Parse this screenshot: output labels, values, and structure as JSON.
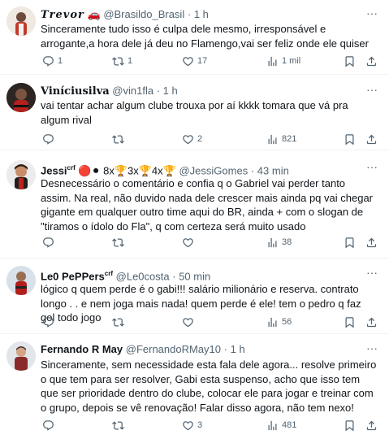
{
  "tweets": [
    {
      "name": "𝑻𝒓𝒆𝒗𝒐𝒓",
      "name_emoji": "🚗",
      "handle": "@Brasildo_Brasil",
      "time": "1 h",
      "text": "Sinceramente tudo isso é culpa dele mesmo, irresponsável e arrogante,a hora dele já deu no Flamengo,vai ser feliz onde ele quiser",
      "replies": "1",
      "retweets": "1",
      "likes": "17",
      "views": "1 mil"
    },
    {
      "name": "Viníciusilva",
      "handle": "@vin1fla",
      "time": "1 h",
      "text": "vai tentar achar algum clube trouxa por aí kkkk tomara que vá pra algum rival",
      "replies": "",
      "retweets": "",
      "likes": "2",
      "views": "821"
    },
    {
      "name": "Jessi",
      "name_sup": "crf",
      "name_badges": "🔴⚫ 8x🏆3x🏆4x🏆",
      "handle": "@JessiGomes",
      "time": "43 min",
      "text": "Desnecessário o comentário e confia q o Gabriel vai perder tanto assim. Na real, não duvido nada dele crescer mais ainda pq vai chegar gigante em qualquer outro time aqui do BR, ainda + com o slogan de \"tiramos o ídolo do Fla\", q com certeza será muito usado",
      "replies": "",
      "retweets": "",
      "likes": "",
      "views": "38"
    },
    {
      "name": "Le0 PePPers",
      "name_sup": "crf",
      "handle": "@Le0costa",
      "time": "50 min",
      "text": "lógico q quem perde é o gabi!!! salário milionário e reserva. contrato longo . . e nem joga mais nada! quem perde é ele! tem o pedro q faz gol todo jogo",
      "replies": "",
      "retweets": "",
      "likes": "",
      "views": "56"
    },
    {
      "name": "Fernando R May",
      "handle": "@FernandoRMay10",
      "time": "1 h",
      "text": "Sinceramente, sem necessidade esta fala dele agora... resolve primeiro o que tem para ser resolver, Gabi esta suspenso, acho que isso tem que ser prioridade dentro do clube, colocar ele para jogar e treinar com o grupo, depois se vê renovação! Falar disso agora, não tem nexo!",
      "replies": "",
      "retweets": "",
      "likes": "3",
      "views": "481"
    }
  ],
  "colors": {
    "text": "#0f1419",
    "secondary": "#536471",
    "divider": "#eff3f4"
  },
  "icons": [
    "reply-icon",
    "retweet-icon",
    "like-icon",
    "views-icon",
    "bookmark-icon",
    "share-icon",
    "more-icon"
  ],
  "separator": "·",
  "more_glyph": "···"
}
